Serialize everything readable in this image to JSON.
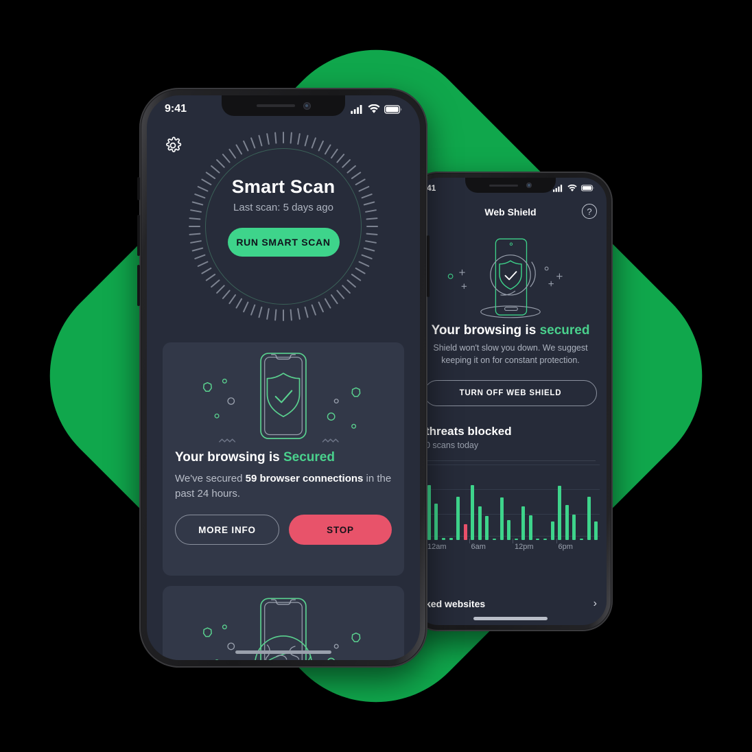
{
  "theme": {
    "background_green": "#10a74c",
    "screen_bg": "#272c3a",
    "card_bg": "#323848",
    "accent_green": "#3ed48b",
    "danger_red": "#e8536a",
    "text_primary": "#ffffff",
    "text_secondary": "#b9bec9"
  },
  "front_phone": {
    "status_bar": {
      "clock": "9:41",
      "icons": [
        "cellular-signal-icon",
        "wifi-icon",
        "battery-icon"
      ]
    },
    "settings_icon": "gear-icon",
    "smart_scan": {
      "title": "Smart Scan",
      "subtitle": "Last scan: 5 days ago",
      "button_label": "RUN SMART SCAN",
      "dial_ticks": 72
    },
    "web_shield_card": {
      "illustration": "phone-with-shield-check-icon",
      "heading_prefix": "Your browsing is ",
      "heading_status": "Secured",
      "body_prefix": "We've secured ",
      "body_highlight": "59 browser connections",
      "body_suffix": " in the past 24 hours.",
      "buttons": [
        {
          "label": "MORE INFO",
          "style": "ghost"
        },
        {
          "label": "STOP",
          "style": "danger"
        }
      ]
    },
    "vpn_card": {
      "illustration": "phone-with-globe-wifi-icon"
    }
  },
  "back_phone": {
    "status_bar": {
      "clock": "41",
      "icons": [
        "cellular-signal-icon",
        "wifi-icon",
        "battery-icon"
      ]
    },
    "header": {
      "title": "Web Shield",
      "help_icon": "question-mark-icon",
      "help_label": "?"
    },
    "illustration": "phone-shield-check-circle-icon",
    "status": {
      "heading_prefix": "Your browsing is ",
      "heading_status": "secured",
      "description": "Shield won't slow you down. We suggest keeping it on for constant protection."
    },
    "turn_off_button": "TURN OFF WEB SHIELD",
    "stats": {
      "threats_blocked": "threats blocked",
      "scans_today": "0 scans today"
    },
    "blocked_row": {
      "label": "ked websites",
      "chevron_icon": "chevron-right-icon"
    }
  },
  "chart_data": {
    "type": "bar",
    "title": "threats blocked",
    "xlabel": "",
    "ylabel": "",
    "grid": true,
    "gridlines": 4,
    "ylim": [
      0,
      100
    ],
    "xticks": [
      "12am",
      "6am",
      "12pm",
      "6pm"
    ],
    "categories": [
      "0",
      "1",
      "2",
      "3",
      "4",
      "5",
      "6",
      "7",
      "8",
      "9",
      "10",
      "11",
      "12",
      "13",
      "14",
      "15",
      "16",
      "17",
      "18",
      "19",
      "20",
      "21",
      "22",
      "23"
    ],
    "values": [
      73,
      48,
      3,
      3,
      57,
      21,
      73,
      45,
      32,
      1,
      56,
      26,
      2,
      45,
      33,
      2,
      2,
      25,
      72,
      46,
      34,
      2,
      57,
      25
    ],
    "colors": [
      "green",
      "green",
      "green",
      "green",
      "green",
      "red",
      "green",
      "green",
      "green",
      "green",
      "green",
      "green",
      "green",
      "green",
      "green",
      "green",
      "green",
      "green",
      "green",
      "green",
      "green",
      "green",
      "green",
      "green"
    ],
    "series": [
      {
        "name": "Blocked threats",
        "values": [
          73,
          48,
          3,
          3,
          57,
          21,
          73,
          45,
          32,
          1,
          56,
          26,
          2,
          45,
          33,
          2,
          2,
          25,
          72,
          46,
          34,
          2,
          57,
          25
        ]
      }
    ],
    "legend": []
  }
}
